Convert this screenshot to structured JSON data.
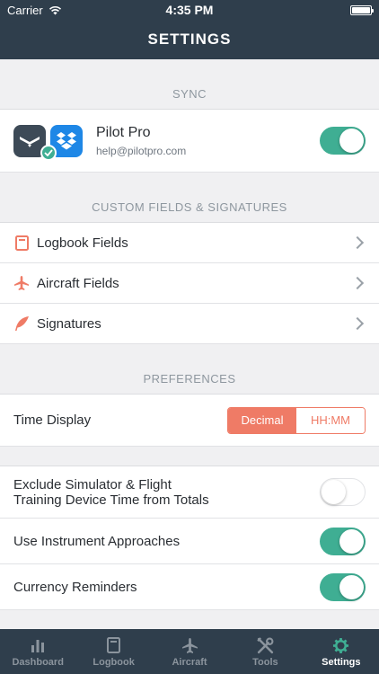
{
  "status": {
    "carrier": "Carrier",
    "time": "4:35 PM"
  },
  "nav": {
    "title": "SETTINGS"
  },
  "sync": {
    "header": "SYNC",
    "title": "Pilot Pro",
    "email": "help@pilotpro.com",
    "enabled": true
  },
  "custom": {
    "header": "CUSTOM FIELDS & SIGNATURES",
    "items": [
      {
        "label": "Logbook Fields",
        "icon": "book-icon"
      },
      {
        "label": "Aircraft Fields",
        "icon": "airplane-icon"
      },
      {
        "label": "Signatures",
        "icon": "feather-icon"
      }
    ]
  },
  "preferences": {
    "header": "PREFERENCES",
    "time_display": {
      "label": "Time Display",
      "options": [
        "Decimal",
        "HH:MM"
      ],
      "selected": "Decimal"
    },
    "toggles": [
      {
        "label_line1": "Exclude Simulator & Flight",
        "label_line2": "Training Device Time from Totals",
        "on": false
      },
      {
        "label": "Use Instrument Approaches",
        "on": true
      },
      {
        "label": "Currency Reminders",
        "on": true
      }
    ]
  },
  "tabs": [
    {
      "label": "Dashboard",
      "icon": "bar-chart-icon",
      "active": false
    },
    {
      "label": "Logbook",
      "icon": "book-icon",
      "active": false
    },
    {
      "label": "Aircraft",
      "icon": "airplane-icon",
      "active": false
    },
    {
      "label": "Tools",
      "icon": "tools-icon",
      "active": false
    },
    {
      "label": "Settings",
      "icon": "gear-icon",
      "active": true
    }
  ],
  "colors": {
    "bar": "#2f3e4c",
    "accent": "#ef7b66",
    "toggle_on": "#3fae93",
    "dropbox": "#1e87e6"
  }
}
